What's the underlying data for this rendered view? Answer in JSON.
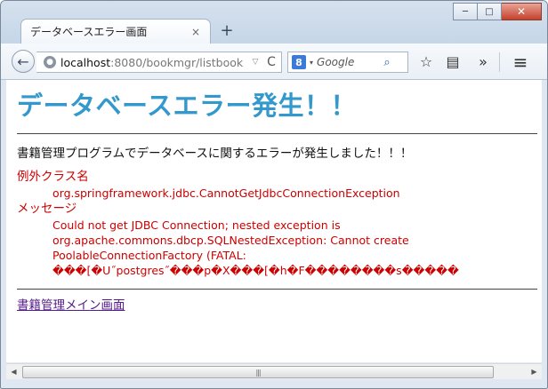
{
  "window": {
    "controls": {
      "minimize": "─",
      "maximize": "□",
      "close": "✕"
    }
  },
  "tab": {
    "title": "データベースエラー画面",
    "close": "×"
  },
  "new_tab": "+",
  "navigation": {
    "back": "←",
    "url_host": "localhost",
    "url_path": ":8080/bookmgr/listbook",
    "url_dropdown": "▽",
    "reload": "C"
  },
  "search": {
    "engine_letter": "8",
    "dropdown": "▾",
    "placeholder": "Google",
    "button": "⌕"
  },
  "toolbar": {
    "bookmark": "☆",
    "reading_list": "▤",
    "overflow": "»",
    "menu": "≡"
  },
  "page": {
    "heading": "データベースエラー発生！！",
    "message": "書籍管理プログラムでデータベースに関するエラーが発生しました！！！",
    "exception_class_label": "例外クラス名",
    "exception_class": "org.springframework.jdbc.CannotGetJdbcConnectionException",
    "message_label": "メッセージ",
    "message_lines": [
      "Could not get JDBC Connection; nested exception is",
      "org.apache.commons.dbcp.SQLNestedException: Cannot create",
      "PoolableConnectionFactory (FATAL:",
      "���[�U˝postgres˝���p�X���[�h�F��������s�����"
    ],
    "main_link": "書籍管理メイン画面"
  },
  "scrollbar": {
    "left": "◀",
    "right": "▶",
    "grip": "|||"
  }
}
